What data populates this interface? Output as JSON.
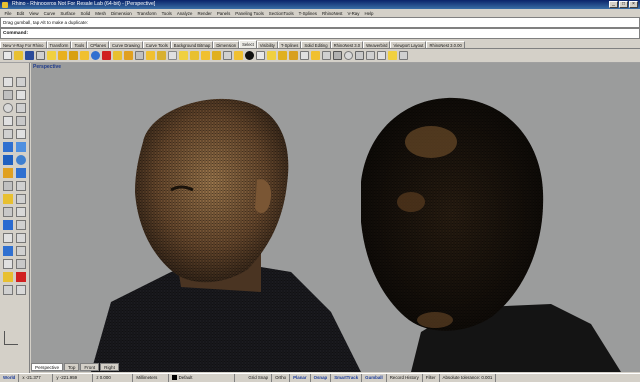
{
  "window": {
    "title": "Rhino - Rhinoceros Not For Resale Lab (64-bit) - [Perspective]"
  },
  "menu": [
    "File",
    "Edit",
    "View",
    "Curve",
    "Surface",
    "Solid",
    "Mesh",
    "Dimension",
    "Transform",
    "Tools",
    "Analyze",
    "Render",
    "Panels",
    "Paneling Tools",
    "SectionTools",
    "T-Splines",
    "RhinoNest",
    "V-Ray",
    "Help"
  ],
  "command": {
    "history": "Drag gumball, tap Alt to make a duplicate:",
    "prompt": "Command:"
  },
  "toolbar_tabs": [
    "New V-Ray For Rhino",
    "Transform",
    "Tools",
    "CPlanes",
    "Curve Drawing",
    "Curve Tools",
    "Background Bitmap",
    "Dimension",
    "Select",
    "Visibility",
    "T-Splines",
    "Solid Editing",
    "RhinoNest 3.0",
    "Weaverbird",
    "Viewport Layout",
    "RhinoNest 3.0.00"
  ],
  "toolbar_active": "Select",
  "viewport": {
    "title": "Perspective",
    "tabs": [
      "Perspective",
      "Top",
      "Front",
      "Right"
    ]
  },
  "status": {
    "cplane": "World",
    "x": "x -21.377",
    "y": "y -221.959",
    "z": "z 0.000",
    "units": "Millimeters",
    "layer": "Default",
    "toggles": [
      "Grid Snap",
      "Ortho",
      "Planar",
      "Osnap",
      "SmartTrack",
      "Gumball",
      "Record History",
      "Filter"
    ],
    "tolerance": "Absolute tolerance: 0.001"
  },
  "colors": {
    "viewport_bg": "#9b9c9c",
    "title_blue": "#0a246a",
    "status_active": "#1a3b9a"
  }
}
